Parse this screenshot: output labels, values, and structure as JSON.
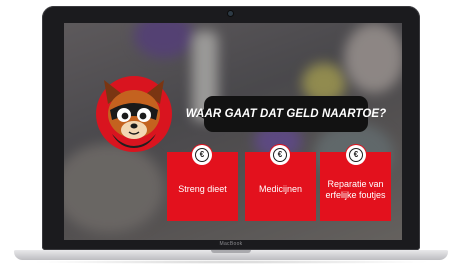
{
  "device": {
    "brand_label": "MacBook"
  },
  "slide": {
    "question": "WAAR GAAT DAT GELD NAARTOE?",
    "options": [
      {
        "label": "Streng dieet",
        "icon": "euro-icon"
      },
      {
        "label": "Medicijnen",
        "icon": "euro-icon"
      },
      {
        "label": "Reparatie van erfelijke foutjes",
        "icon": "euro-icon"
      }
    ],
    "icon_glyph": "€"
  },
  "colors": {
    "card_red": "#e3111d",
    "bubble_black": "#121212",
    "laptop_bezel": "#1b1b1e"
  }
}
